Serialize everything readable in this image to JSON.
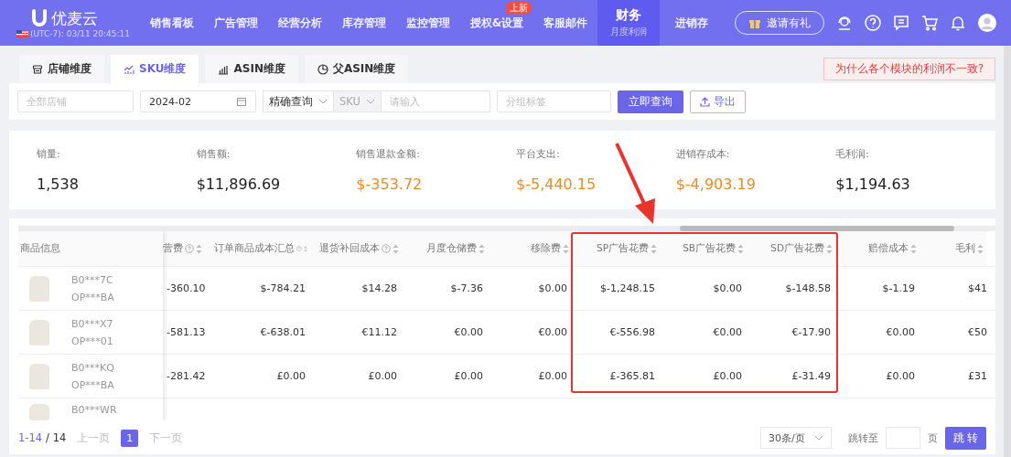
{
  "header": {
    "logo": "优麦云",
    "timezone": "(UTC-7): 03/11 20:45:11",
    "invite_button": "邀请有礼",
    "nav": [
      {
        "label": "销售看板",
        "selected": false
      },
      {
        "label": "广告管理",
        "selected": false
      },
      {
        "label": "经营分析",
        "selected": false
      },
      {
        "label": "库存管理",
        "selected": false
      },
      {
        "label": "监控管理",
        "selected": false
      },
      {
        "label": "授权&设置",
        "selected": false,
        "badge": "上新"
      },
      {
        "label": "客服邮件",
        "selected": false
      },
      {
        "label": "财务",
        "selected": true,
        "subtitle": "月度利润"
      },
      {
        "label": "进销存",
        "selected": false
      }
    ]
  },
  "tabs": [
    {
      "label": "店铺维度",
      "selected": false
    },
    {
      "label": "SKU维度",
      "selected": true
    },
    {
      "label": "ASIN维度",
      "selected": false
    },
    {
      "label": "父ASIN维度",
      "selected": false
    }
  ],
  "notice_button": "为什么各个模块的利润不一致?",
  "filters": {
    "store": {
      "placeholder": "全部店铺"
    },
    "month": {
      "value": "2024-02"
    },
    "match_mode": {
      "value": "精确查询"
    },
    "field_type": {
      "value": "SKU"
    },
    "keyword": {
      "placeholder": "请输入"
    },
    "group_tag": {
      "placeholder": "分组标签"
    },
    "query_button": "立即查询",
    "export_button": "导出"
  },
  "stats": [
    {
      "label": "销量:",
      "value": "1,538",
      "highlight": false
    },
    {
      "label": "销售额:",
      "value": "$11,896.69",
      "highlight": false
    },
    {
      "label": "销售退款金额:",
      "value": "$-353.72",
      "highlight": true
    },
    {
      "label": "平台支出:",
      "value": "$-5,440.15",
      "highlight": true
    },
    {
      "label": "进销存成本:",
      "value": "$-4,903.19",
      "highlight": true
    },
    {
      "label": "毛利润:",
      "value": "$1,194.63",
      "highlight": false
    }
  ],
  "table": {
    "product_column": "商品信息",
    "columns": [
      {
        "label": "营费",
        "help": true
      },
      {
        "label": "订单商品成本汇总",
        "help": true
      },
      {
        "label": "退货补回成本",
        "help": true
      },
      {
        "label": "月度仓储费",
        "help": false
      },
      {
        "label": "移除费",
        "help": false
      },
      {
        "label": "SP广告花费",
        "help": false
      },
      {
        "label": "SB广告花费",
        "help": false
      },
      {
        "label": "SD广告花费",
        "help": false
      },
      {
        "label": "赔偿成本",
        "help": false
      },
      {
        "label": "毛利",
        "help": false
      }
    ],
    "rows": [
      {
        "asin": "B0***7C",
        "sku": "OP***BA",
        "cells": [
          "-360.10",
          "$-784.21",
          "$14.28",
          "$-7.36",
          "$0.00",
          "$-1,248.15",
          "$0.00",
          "$-148.58",
          "$-1.19",
          "$41"
        ]
      },
      {
        "asin": "B0***X7",
        "sku": "OP***01",
        "cells": [
          "-581.13",
          "€-638.01",
          "€11.12",
          "€0.00",
          "€0.00",
          "€-556.98",
          "€0.00",
          "€-17.90",
          "€0.00",
          "€50"
        ]
      },
      {
        "asin": "B0***KQ",
        "sku": "OP***BA",
        "cells": [
          "-281.42",
          "£0.00",
          "£0.00",
          "£0.00",
          "£0.00",
          "£-365.81",
          "£0.00",
          "£-31.49",
          "£0.00",
          "£31"
        ]
      },
      {
        "asin": "B0***WR",
        "cells": []
      }
    ]
  },
  "pagination": {
    "range": "1-14",
    "total": "/ 14",
    "prev": "上一页",
    "pages": [
      {
        "label": "1",
        "selected": true
      }
    ],
    "next": "下一页",
    "page_size": "30条/页",
    "jump_label": "跳转至",
    "page_unit": "页",
    "jump_button": "跳 转"
  }
}
